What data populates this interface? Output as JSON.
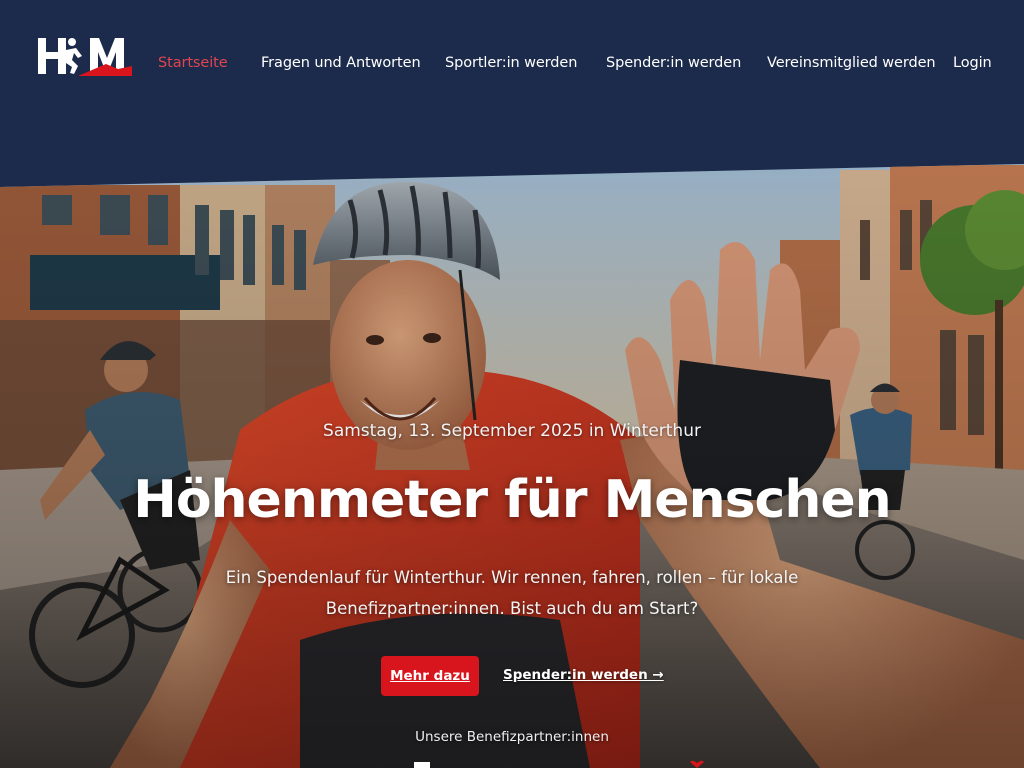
{
  "nav": {
    "logo_text": "HFM",
    "items": [
      {
        "label": "Startseite",
        "active": true
      },
      {
        "label": "Fragen und Antworten",
        "active": false
      },
      {
        "label": "Sportler:in werden",
        "active": false
      },
      {
        "label": "Spender:in werden",
        "active": false
      },
      {
        "label": "Vereinsmitglied werden",
        "active": false
      },
      {
        "label": "Login",
        "active": false
      }
    ]
  },
  "hero": {
    "date": "Samstag, 13. September 2025 in Winterthur",
    "headline": "Höhenmeter für Menschen",
    "lead": "Ein Spendenlauf für Winterthur. Wir rennen, fahren, rollen – für lokale Benefizpartner:innen. Bist auch du am Start?",
    "primary_button": "Mehr dazu",
    "secondary_link": "Spender:in werden →",
    "partners_heading": "Unsere Benefizpartner:innen"
  },
  "colors": {
    "header_bg": "#1c2b4b",
    "active_nav": "#e0454f",
    "primary_button": "#d8151d",
    "text": "#ffffff"
  },
  "icons": [
    "logo",
    "partner-logo",
    "heart-icon"
  ]
}
